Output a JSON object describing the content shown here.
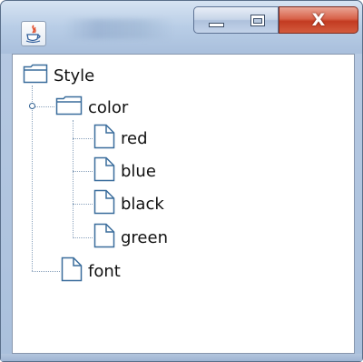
{
  "window": {
    "title": "",
    "controls": {
      "minimize": "minimize-icon",
      "maximize": "maximize-icon",
      "close": "close-icon",
      "close_glyph": "X"
    }
  },
  "tree": {
    "root": {
      "label": "Style",
      "icon": "folder-icon"
    },
    "color_folder": {
      "label": "color",
      "icon": "folder-icon",
      "expanded": true
    },
    "color_items": [
      {
        "label": "red",
        "icon": "file-icon"
      },
      {
        "label": "blue",
        "icon": "file-icon"
      },
      {
        "label": "black",
        "icon": "file-icon"
      },
      {
        "label": "green",
        "icon": "file-icon"
      }
    ],
    "font_item": {
      "label": "font",
      "icon": "file-icon"
    }
  },
  "colors": {
    "titlebar": "#b8cde6",
    "close_button": "#c33b21",
    "tree_line": "#8aa2bc",
    "folder_outline": "#3a6d9c"
  }
}
